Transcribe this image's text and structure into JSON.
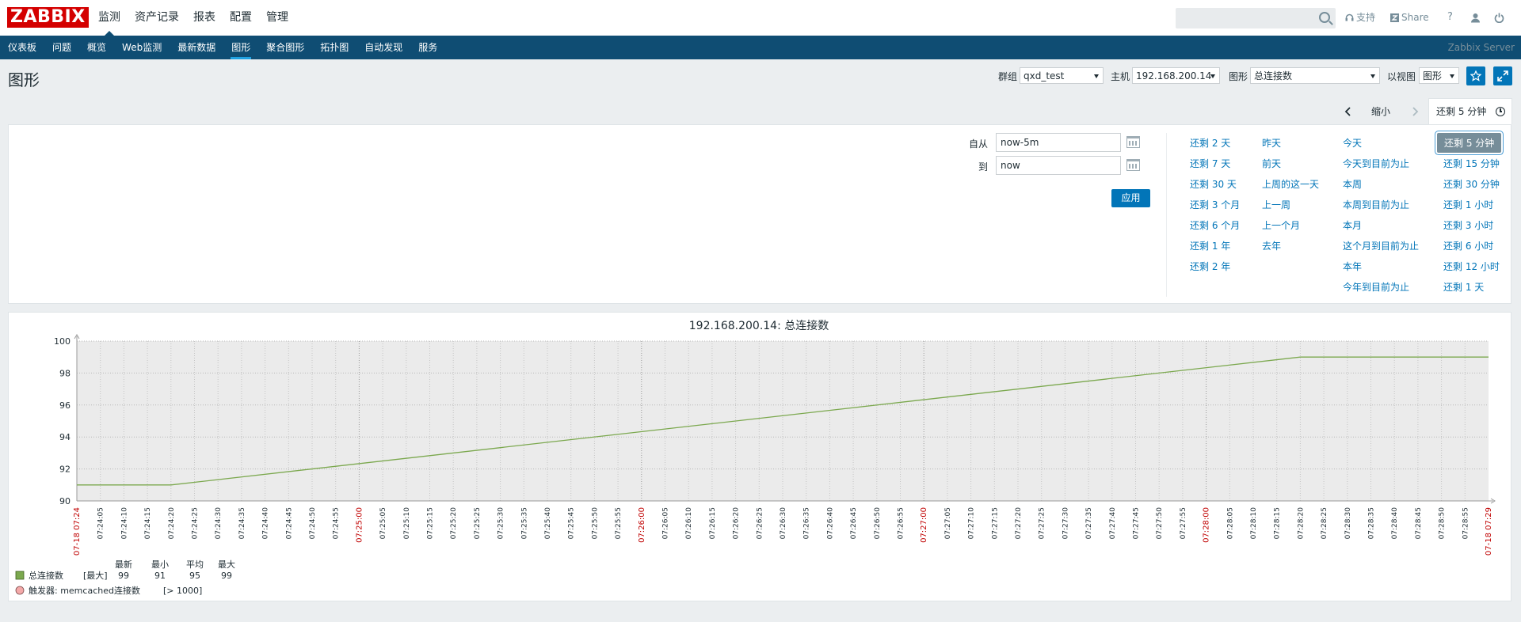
{
  "header": {
    "logo": "ZABBIX",
    "nav": [
      "监测",
      "资产记录",
      "报表",
      "配置",
      "管理"
    ],
    "active_nav": 0,
    "support": "支持",
    "share": "Share",
    "help": "?"
  },
  "subnav": {
    "items": [
      "仪表板",
      "问题",
      "概览",
      "Web监测",
      "最新数据",
      "图形",
      "聚合图形",
      "拓扑图",
      "自动发现",
      "服务"
    ],
    "active": 5,
    "server": "Zabbix Server"
  },
  "page": {
    "title": "图形",
    "group_label": "群组",
    "group_value": "qxd_test",
    "host_label": "主机",
    "host_value": "192.168.200.14",
    "graph_label": "图形",
    "graph_value": "总连接数",
    "view_label": "以视图",
    "view_value": "图形"
  },
  "timebar": {
    "zoom_out": "缩小",
    "active_tab": "还剩 5 分钟"
  },
  "filter": {
    "from_label": "自从",
    "from_value": "now-5m",
    "to_label": "到",
    "to_value": "now",
    "apply": "应用",
    "quick": [
      [
        "还剩 2 天",
        "还剩 7 天",
        "还剩 30 天",
        "还剩 3 个月",
        "还剩 6 个月",
        "还剩 1 年",
        "还剩 2 年"
      ],
      [
        "昨天",
        "前天",
        "上周的这一天",
        "上一周",
        "上一个月",
        "去年"
      ],
      [
        "今天",
        "今天到目前为止",
        "本周",
        "本周到目前为止",
        "本月",
        "这个月到目前为止",
        "本年",
        "今年到目前为止"
      ],
      [
        "还剩 5 分钟",
        "还剩 15 分钟",
        "还剩 30 分钟",
        "还剩 1 小时",
        "还剩 3 小时",
        "还剩 6 小时",
        "还剩 12 小时",
        "还剩 1 天"
      ]
    ],
    "selected_quick": "还剩 5 分钟"
  },
  "chart_data": {
    "type": "line",
    "title": "192.168.200.14: 总连接数",
    "ylim": [
      90,
      100
    ],
    "yticks": [
      90,
      92,
      94,
      96,
      98,
      100
    ],
    "xlim": [
      "07:24:00",
      "07:29:00"
    ],
    "start_label": "07-18 07:24",
    "end_label": "07-18 07:29",
    "major_ticks": [
      "07:25:00",
      "07:26:00",
      "07:27:00",
      "07:28:00",
      "07:29:00"
    ],
    "series": [
      {
        "name": "总连接数",
        "color": "#7ba84e",
        "x": [
          "07:24:00",
          "07:24:20",
          "07:28:20",
          "07:29:00"
        ],
        "y": [
          91,
          91,
          99,
          99
        ]
      }
    ],
    "legend": {
      "headers": [
        "最新",
        "最小",
        "平均",
        "最大"
      ],
      "rows": [
        {
          "name": "总连接数",
          "func": "[最大]",
          "last": "99",
          "min": "91",
          "avg": "95",
          "max": "99",
          "color": "#7ba84e"
        }
      ],
      "trigger": {
        "name": "触发器: memcached连接数",
        "cond": "[> 1000]",
        "color": "#f4a9a9"
      }
    },
    "grid": true,
    "label_colors": {
      "minor": "#1f2c33",
      "major": "#c00000"
    }
  }
}
